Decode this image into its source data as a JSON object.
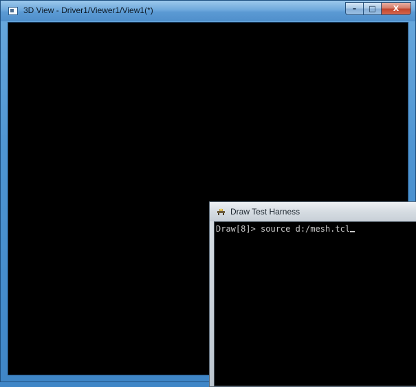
{
  "main_window": {
    "title": "3D View - Driver1/Viewer1/View1(*)",
    "buttons": {
      "minimize": "–",
      "maximize": "□",
      "close": "X"
    },
    "icon": "window-icon"
  },
  "console_window": {
    "title": "Draw Test Harness",
    "icon": "draw-harness-icon",
    "prompt": "Draw[8]>",
    "command": "source d:/mesh.tcl"
  },
  "colors": {
    "viewport": "#000000",
    "console_text": "#c8c8c8",
    "accent": "#4f8fcb"
  }
}
